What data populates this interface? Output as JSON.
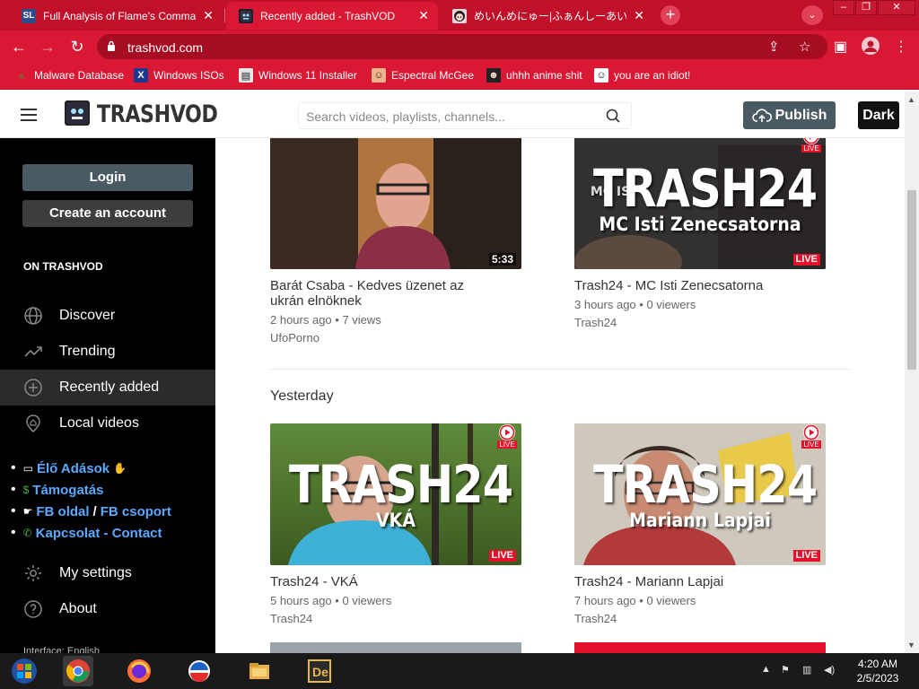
{
  "browser": {
    "tabs": [
      {
        "favicon": "SL",
        "title": "Full Analysis of Flame's Command",
        "active": false
      },
      {
        "favicon": "",
        "title": "Recently added - TrashVOD",
        "active": true
      },
      {
        "favicon": "",
        "title": "めいんめにゅー|ふぁんしーあいらんど",
        "active": false
      }
    ],
    "url": "trashvod.com",
    "bookmarks": [
      {
        "label": "Malware Database",
        "icon": "poop-icon"
      },
      {
        "label": "Windows ISOs",
        "icon": "x-icon"
      },
      {
        "label": "Windows 11 Installer",
        "icon": "window-icon"
      },
      {
        "label": "Espectral McGee",
        "icon": "face-icon"
      },
      {
        "label": "uhhh anime shit",
        "icon": "anime-icon"
      },
      {
        "label": "you are an idiot!",
        "icon": "smiley-icon"
      }
    ]
  },
  "header": {
    "logo": "TRASHVOD",
    "search_placeholder": "Search videos, playlists, channels...",
    "publish": "Publish",
    "dark": "Dark"
  },
  "sidebar": {
    "login": "Login",
    "create_account": "Create an account",
    "section_title": "ON TRASHVOD",
    "nav": [
      {
        "label": "Discover",
        "icon": "globe-icon"
      },
      {
        "label": "Trending",
        "icon": "trending-icon"
      },
      {
        "label": "Recently added",
        "icon": "plus-circle-icon",
        "active": true
      },
      {
        "label": "Local videos",
        "icon": "home-pin-icon"
      }
    ],
    "links": {
      "live": "Élő Adások",
      "support": "Támogatás",
      "fb_page": "FB oldal",
      "fb_sep": "/",
      "fb_group": "FB csoport",
      "contact": "Kapcsolat - Contact"
    },
    "nav_bottom": [
      {
        "label": "My settings",
        "icon": "gear-icon"
      },
      {
        "label": "About",
        "icon": "question-icon"
      }
    ],
    "cut_text": "Interface: English"
  },
  "main": {
    "section_yesterday": "Yesterday",
    "videos": [
      {
        "title": "Barát Csaba - Kedves üzenet az ukrán elnöknek",
        "meta": "2 hours ago • 7 views",
        "channel": "UfoPorno",
        "duration": "5:33",
        "live": false
      },
      {
        "title": "Trash24 - MC Isti Zenecsatorna",
        "meta": "3 hours ago • 0 viewers",
        "channel": "Trash24",
        "overlay_big": "TRASH24",
        "overlay_sub": "MC Isti Zenecsatorna",
        "bg_text": "MC IS",
        "live_badge": "LIVE",
        "live_icon_text": "LIVE",
        "live": true
      },
      {
        "title": "Trash24 - VKÁ",
        "meta": "5 hours ago • 0 viewers",
        "channel": "Trash24",
        "overlay_big": "TRASH24",
        "overlay_sub": "VKÁ",
        "live_badge": "LIVE",
        "live_icon_text": "LIVE",
        "live": true
      },
      {
        "title": "Trash24 - Mariann Lapjai",
        "meta": "7 hours ago • 0 viewers",
        "channel": "Trash24",
        "overlay_big": "TRASH24",
        "overlay_sub": "Mariann Lapjai",
        "live_badge": "LIVE",
        "live_icon_text": "LIVE",
        "live": true
      }
    ]
  },
  "taskbar": {
    "time": "4:20 AM",
    "date": "2/5/2023",
    "apps": [
      "start-orb-icon",
      "chrome-icon",
      "firefox-icon",
      "ie-icon",
      "explorer-icon",
      "de-app-icon"
    ]
  },
  "colors": {
    "chrome_red": "#d91833",
    "tab_red": "#c0102a",
    "sidebar_bg": "#000000",
    "link_blue": "#5aa9ff",
    "live_red": "#e5102a",
    "publish_bg": "#4a5a62"
  }
}
